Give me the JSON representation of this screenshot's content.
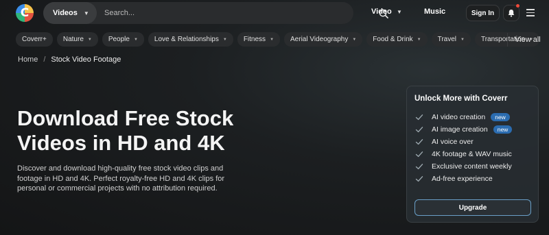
{
  "header": {
    "logo_name": "coverr-logo",
    "search": {
      "type_label": "Videos",
      "placeholder": "Search..."
    },
    "nav": {
      "video_label": "Video",
      "music_label": "Music"
    },
    "signin_label": "Sign In",
    "notification_dot_color": "#ef4a3a"
  },
  "categories": [
    {
      "label": "Coverr+",
      "has_menu": false
    },
    {
      "label": "Nature",
      "has_menu": true
    },
    {
      "label": "People",
      "has_menu": true
    },
    {
      "label": "Love & Relationships",
      "has_menu": true
    },
    {
      "label": "Fitness",
      "has_menu": true
    },
    {
      "label": "Aerial Videography",
      "has_menu": true
    },
    {
      "label": "Food & Drink",
      "has_menu": true
    },
    {
      "label": "Travel",
      "has_menu": true
    },
    {
      "label": "Transportation",
      "has_menu": true
    }
  ],
  "view_all_label": "View all",
  "breadcrumb": {
    "home": "Home",
    "separator": "/",
    "current": "Stock Video Footage"
  },
  "hero": {
    "title": "Download Free Stock Videos in HD and 4K",
    "description": "Discover and download high-quality free stock video clips and footage in HD and 4K. Perfect royalty-free HD and 4K clips for personal or commercial projects with no attribution required."
  },
  "promo": {
    "title": "Unlock More with Coverr",
    "features": [
      {
        "label": "AI video creation",
        "badge": "new"
      },
      {
        "label": "AI image creation",
        "badge": "new"
      },
      {
        "label": "AI voice over",
        "badge": ""
      },
      {
        "label": "4K footage & WAV music",
        "badge": ""
      },
      {
        "label": "Exclusive content weekly",
        "badge": ""
      },
      {
        "label": "Ad-free experience",
        "badge": ""
      }
    ],
    "button_label": "Upgrade",
    "badge_color": "#2b6cb0"
  }
}
